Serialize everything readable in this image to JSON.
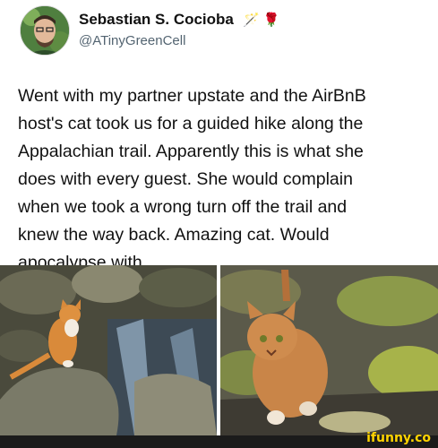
{
  "author": {
    "name": "Sebastian S. Cocioba",
    "handle": "@ATinyGreenCell",
    "badge_wand": "🪄",
    "badge_rose": "🌹",
    "avatar_icon": "avatar-photo"
  },
  "tweet": {
    "text": "Went with my partner upstate and the AirBnB\nhost's cat took us for a guided hike along the\nAppalachian trail. Apparently this is what she\ndoes with every guest. She would complain\nwhen we took a wrong turn off the trail and\nknew the way back. Amazing cat. Would\napocalypse with."
  },
  "media": {
    "left_photo": "cat-on-rock-photo",
    "right_photo": "cat-walking-photo"
  },
  "watermark": {
    "label": "ifunny.co"
  },
  "colors": {
    "name": "#111111",
    "handle": "#536471",
    "watermark": "#ffd400",
    "footer_bg": "#1b1b1b"
  }
}
